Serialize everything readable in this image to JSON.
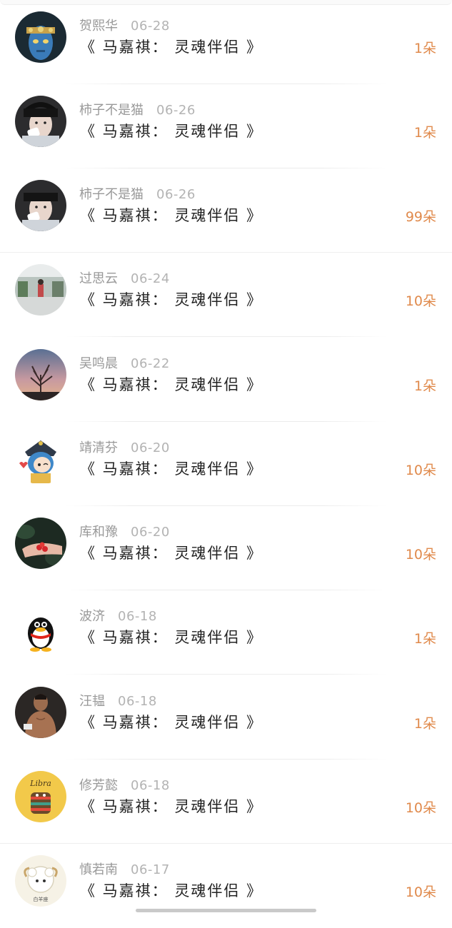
{
  "records": [
    {
      "user": "贺熙华",
      "date": "06-28",
      "title": "《 马嘉祺： 灵魂伴侣 》",
      "count": "1朵",
      "avatar": "avatar-blue-alien"
    },
    {
      "user": "柿子不是猫",
      "date": "06-26",
      "title": "《 马嘉祺： 灵魂伴侣 》",
      "count": "1朵",
      "avatar": "avatar-boy-tissue"
    },
    {
      "user": "柿子不是猫",
      "date": "06-26",
      "title": "《 马嘉祺： 灵魂伴侣 》",
      "count": "99朵",
      "avatar": "avatar-boy-tissue"
    },
    {
      "user": "过思云",
      "date": "06-24",
      "title": "《 马嘉祺： 灵魂伴侣 》",
      "count": "10朵",
      "avatar": "avatar-street-scene"
    },
    {
      "user": "吴鸣晨",
      "date": "06-22",
      "title": "《 马嘉祺： 灵魂伴侣 》",
      "count": "1朵",
      "avatar": "avatar-sunset-tree"
    },
    {
      "user": "靖清芬",
      "date": "06-20",
      "title": "《 马嘉祺： 灵魂伴侣 》",
      "count": "10朵",
      "avatar": "avatar-anime-girl"
    },
    {
      "user": "库和豫",
      "date": "06-20",
      "title": "《 马嘉祺： 灵魂伴侣 》",
      "count": "10朵",
      "avatar": "avatar-hands-strawberries"
    },
    {
      "user": "波济",
      "date": "06-18",
      "title": "《 马嘉祺： 灵魂伴侣 》",
      "count": "1朵",
      "avatar": "avatar-qq-penguin"
    },
    {
      "user": "汪韫",
      "date": "06-18",
      "title": "《 马嘉祺： 灵魂伴侣 》",
      "count": "1朵",
      "avatar": "avatar-muscle-man"
    },
    {
      "user": "修芳懿",
      "date": "06-18",
      "title": "《 马嘉祺： 灵魂伴侣 》",
      "count": "10朵",
      "avatar": "avatar-libra"
    },
    {
      "user": "慎若南",
      "date": "06-17",
      "title": "《 马嘉祺： 灵魂伴侣 》",
      "count": "10朵",
      "avatar": "avatar-cartoon-sheep"
    }
  ],
  "avatar_art": {
    "libra_text": "Libra",
    "sheep_caption": "白羊座"
  },
  "colors": {
    "count": "#e08a4c",
    "username": "#999999",
    "date": "#b3b3b3",
    "title": "#222222"
  }
}
